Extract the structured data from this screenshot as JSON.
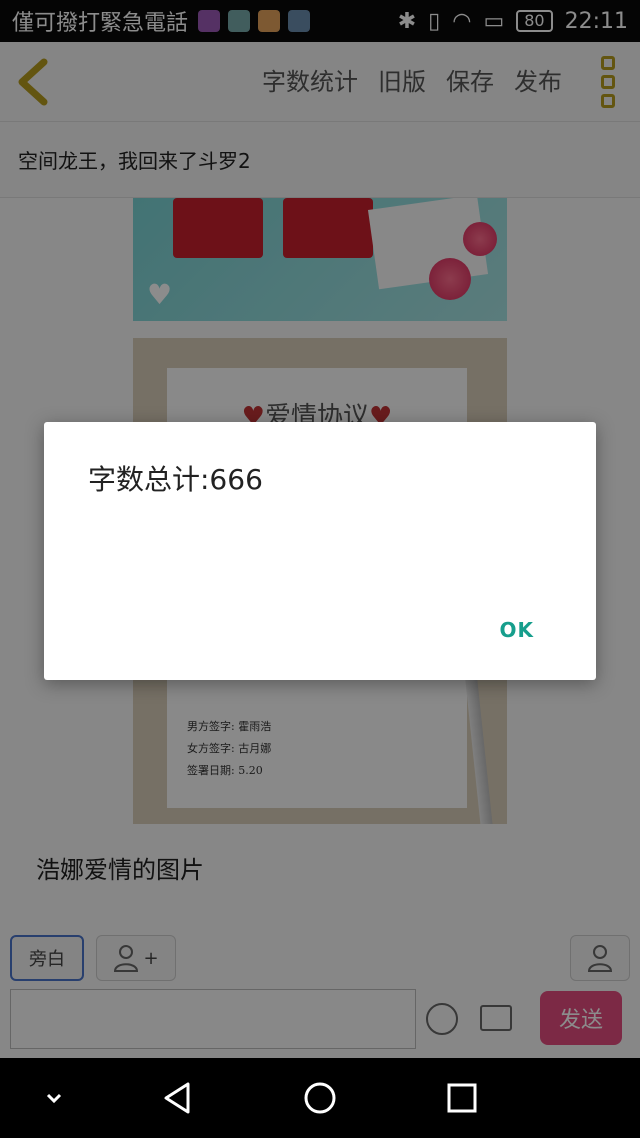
{
  "status_bar": {
    "carrier": "僅可撥打緊急電話",
    "battery": "80",
    "time": "22:11",
    "icons": [
      "bluetooth-icon",
      "vibrate-icon",
      "wifi-icon",
      "sim-icon"
    ]
  },
  "header": {
    "actions": [
      "字数统计",
      "旧版",
      "保存",
      "发布"
    ],
    "accent_color": "#b59b1e"
  },
  "title": "空间龙王，我回来了斗罗2",
  "content": {
    "agreement_title": "爱情协议",
    "caption": "浩娜爱情的图片",
    "paper_lines": [
      "男方签字: 霍雨浩",
      "女方签字: 古月娜",
      "签署日期: 5.20"
    ]
  },
  "composer": {
    "narration": "旁白",
    "add_role": "+",
    "send": "发送",
    "send_color": "#e24c7f"
  },
  "dialog": {
    "message": "字数总计:666",
    "ok": "OK",
    "ok_color": "#169e8c"
  }
}
